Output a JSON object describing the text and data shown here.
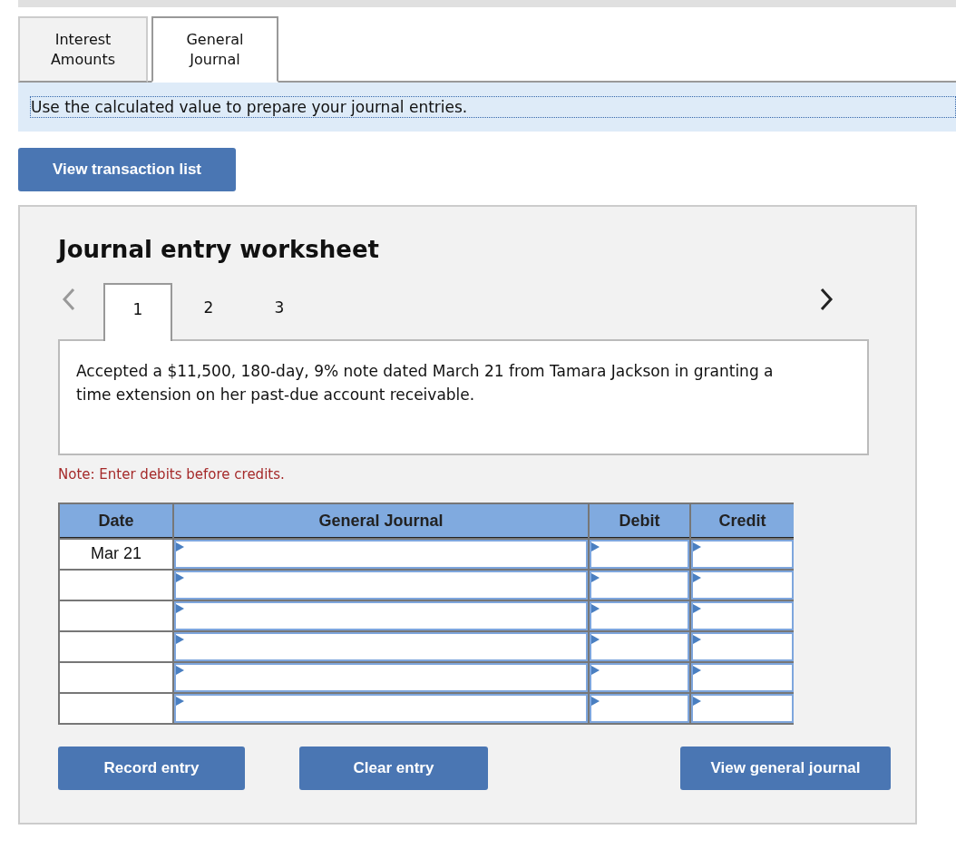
{
  "tabs": [
    {
      "label": "Interest\nAmounts",
      "selected": false
    },
    {
      "label": "General\nJournal",
      "selected": true
    }
  ],
  "instruction": "Use the calculated value to prepare your journal entries.",
  "view_transaction_button": "View transaction list",
  "worksheet": {
    "title": "Journal entry worksheet",
    "steps": [
      {
        "label": "1",
        "selected": true
      },
      {
        "label": "2",
        "selected": false
      },
      {
        "label": "3",
        "selected": false
      }
    ],
    "description": "Accepted a $11,500, 180-day, 9% note dated March 21 from Tamara Jackson in granting a time extension on her past-due account receivable.",
    "note": "Note: Enter debits before credits.",
    "table": {
      "columns": [
        "Date",
        "General Journal",
        "Debit",
        "Credit"
      ],
      "rows": [
        {
          "date": "Mar 21"
        },
        {},
        {},
        {},
        {},
        {}
      ]
    },
    "buttons": [
      "Record entry",
      "Clear entry",
      "View general journal"
    ]
  }
}
